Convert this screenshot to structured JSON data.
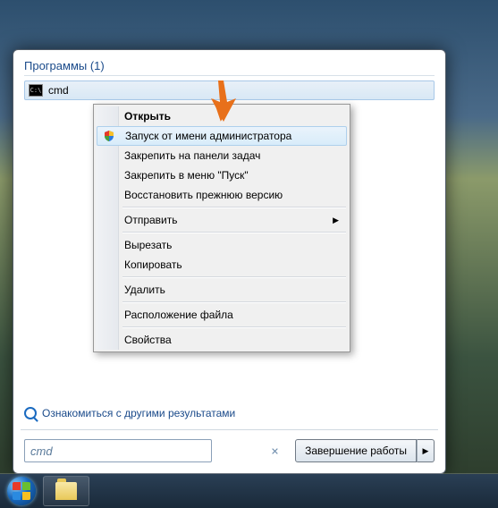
{
  "startmenu": {
    "programs_header": "Программы (1)",
    "result_name": "cmd",
    "more_results": "Ознакомиться с другими результатами",
    "search_value": "cmd",
    "shutdown_label": "Завершение работы"
  },
  "context_menu": {
    "open": "Открыть",
    "run_admin": "Запуск от имени администратора",
    "pin_taskbar": "Закрепить на панели задач",
    "pin_start": "Закрепить в меню \"Пуск\"",
    "restore": "Восстановить прежнюю версию",
    "send_to": "Отправить",
    "cut": "Вырезать",
    "copy": "Копировать",
    "delete": "Удалить",
    "location": "Расположение файла",
    "properties": "Свойства"
  }
}
